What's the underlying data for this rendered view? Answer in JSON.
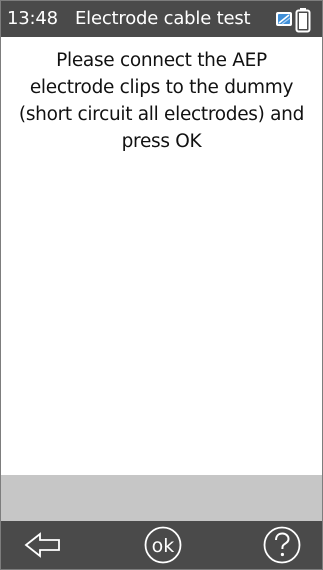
{
  "status_bar": {
    "time": "13:48",
    "title": "Electrode cable test",
    "icons": [
      "connection-icon",
      "battery-icon"
    ]
  },
  "content": {
    "message": "Please connect the AEP electrode clips to the dummy (short circuit all electrodes) and press OK"
  },
  "nav_bar": {
    "back_icon": "back-arrow-icon",
    "ok_label": "ok",
    "help_icon": "help-icon"
  },
  "colors": {
    "bar_background": "#4a4a4a",
    "footer_gray": "#c6c6c6",
    "content_background": "#ffffff",
    "icon_accent": "#3f8fd8"
  }
}
